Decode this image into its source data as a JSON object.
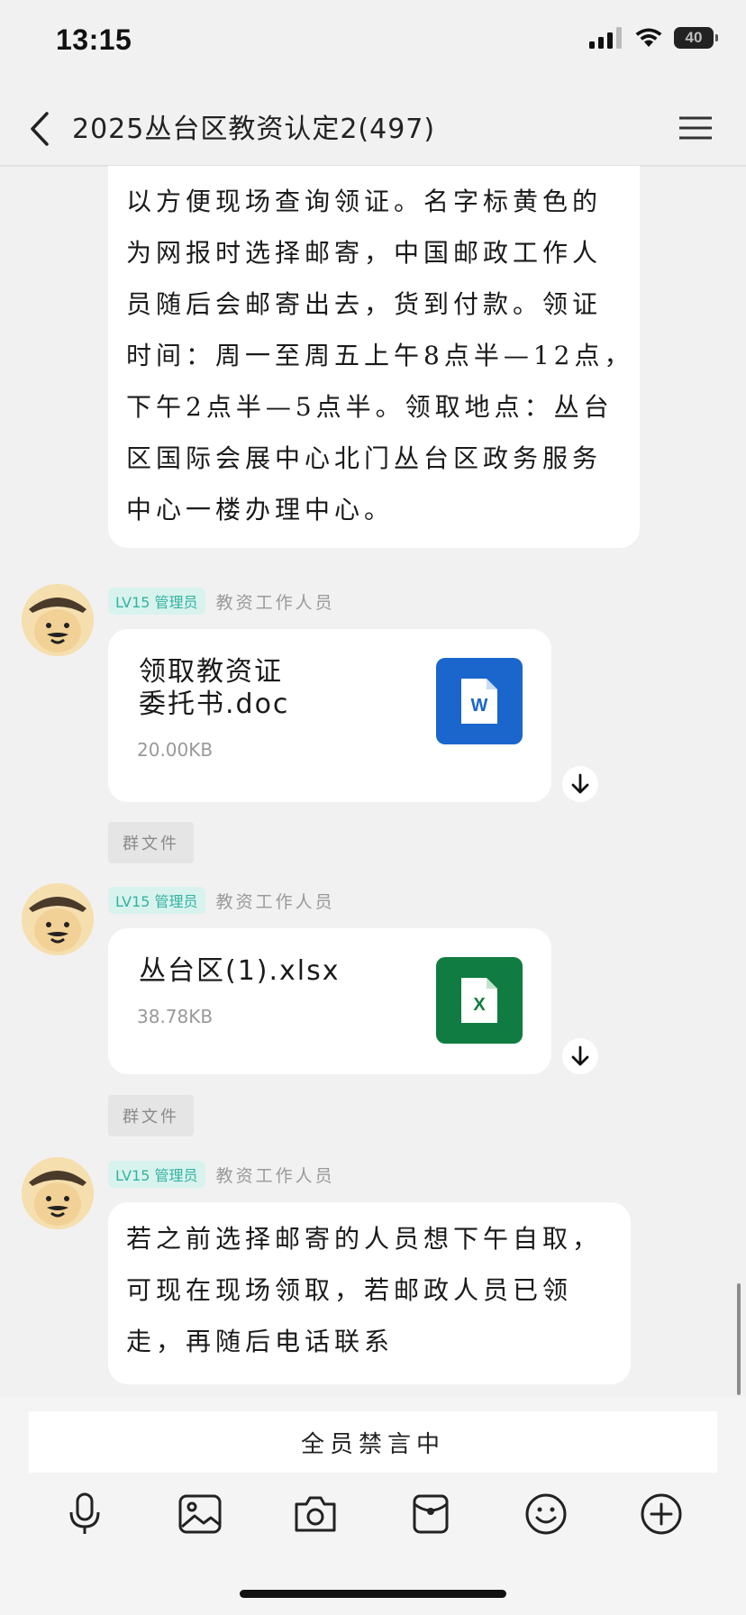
{
  "status": {
    "time": "13:15",
    "battery": "40"
  },
  "header": {
    "title": "2025丛台区教资认定2(497)"
  },
  "messages": {
    "first_lines": [
      "以方便现场查询领证。名字标黄色的",
      "为网报时选择邮寄，中国邮政工作人",
      "员随后会邮寄出去，货到付款。领证",
      "时间：周一至周五上午8点半—12点，",
      "下午2点半—5点半。领取地点：丛台",
      "区国际会展中心北门丛台区政务服务",
      "中心一楼办理中心。"
    ],
    "file1": {
      "badge": "LV15 管理员",
      "sender": "教资工作人员",
      "name_lines": [
        "领取教资证",
        "委托书.doc"
      ],
      "size": "20.00KB",
      "tag": "群文件",
      "icon_letter": "W"
    },
    "file2": {
      "badge": "LV15 管理员",
      "sender": "教资工作人员",
      "name_lines": [
        "丛台区(1).xlsx"
      ],
      "size": "38.78KB",
      "tag": "群文件",
      "icon_letter": "X"
    },
    "last": {
      "badge": "LV15 管理员",
      "sender": "教资工作人员",
      "lines": [
        "若之前选择邮寄的人员想下午自取，",
        "可现在现场领取，若邮政人员已领",
        "走，再随后电话联系"
      ]
    }
  },
  "bottom": {
    "mute_text": "全员禁言中"
  },
  "colors": {
    "word_blue": "#1a66cc",
    "excel_green": "#107c41",
    "badge_teal": "#34b2a0"
  }
}
